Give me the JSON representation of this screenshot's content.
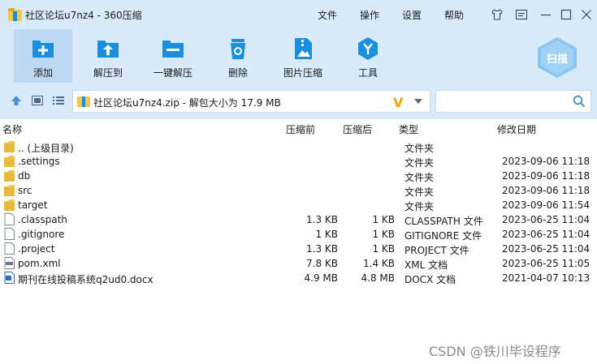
{
  "window": {
    "title": "社区论坛u7nz4 - 360压缩"
  },
  "menu": [
    "文件",
    "操作",
    "设置",
    "帮助"
  ],
  "window_controls": [
    "shirt-icon",
    "message-icon",
    "minimize-icon",
    "maximize-icon",
    "close-icon"
  ],
  "toolbar": [
    {
      "label": "添加",
      "icon": "add-icon"
    },
    {
      "label": "解压到",
      "icon": "extract-to-icon"
    },
    {
      "label": "一键解压",
      "icon": "quick-extract-icon"
    },
    {
      "label": "删除",
      "icon": "delete-icon"
    },
    {
      "label": "图片压缩",
      "icon": "image-compress-icon"
    },
    {
      "label": "工具",
      "icon": "tools-icon"
    }
  ],
  "scan": {
    "label": "扫描"
  },
  "address": {
    "path": "社区论坛u7nz4.zip - 解包大小为 17.9 MB",
    "badge": "V"
  },
  "columns": {
    "name": "名称",
    "before": "压缩前",
    "after": "压缩后",
    "type": "类型",
    "date": "修改日期"
  },
  "files": [
    {
      "name": ".. (上级目录)",
      "before": "",
      "after": "",
      "type": "文件夹",
      "date": "",
      "kind": "folder"
    },
    {
      "name": ".settings",
      "before": "",
      "after": "",
      "type": "文件夹",
      "date": "2023-09-06 11:18",
      "kind": "folder"
    },
    {
      "name": "db",
      "before": "",
      "after": "",
      "type": "文件夹",
      "date": "2023-09-06 11:18",
      "kind": "folder"
    },
    {
      "name": "src",
      "before": "",
      "after": "",
      "type": "文件夹",
      "date": "2023-09-06 11:18",
      "kind": "folder"
    },
    {
      "name": "target",
      "before": "",
      "after": "",
      "type": "文件夹",
      "date": "2023-09-06 11:54",
      "kind": "folder"
    },
    {
      "name": ".classpath",
      "before": "1.3 KB",
      "after": "1 KB",
      "type": "CLASSPATH 文件",
      "date": "2023-06-25 11:04",
      "kind": "file"
    },
    {
      "name": ".gitignore",
      "before": "1 KB",
      "after": "1 KB",
      "type": "GITIGNORE 文件",
      "date": "2023-06-25 11:04",
      "kind": "file"
    },
    {
      "name": ".project",
      "before": "1.3 KB",
      "after": "1 KB",
      "type": "PROJECT 文件",
      "date": "2023-06-25 11:04",
      "kind": "file"
    },
    {
      "name": "pom.xml",
      "before": "7.8 KB",
      "after": "1.4 KB",
      "type": "XML 文档",
      "date": "2023-06-25 11:05",
      "kind": "xml"
    },
    {
      "name": "期刊在线投稿系统q2ud0.docx",
      "before": "4.9 MB",
      "after": "4.8 MB",
      "type": "DOCX 文档",
      "date": "2021-04-07 10:13",
      "kind": "docx"
    }
  ],
  "watermark": "CSDN @铁川毕设程序",
  "colors": {
    "chrome_bg": "#d9ebfa",
    "accent_blue": "#1a8fe0",
    "folder_yellow": "#f2c94c",
    "scan_blue": "#7cc0ef"
  }
}
